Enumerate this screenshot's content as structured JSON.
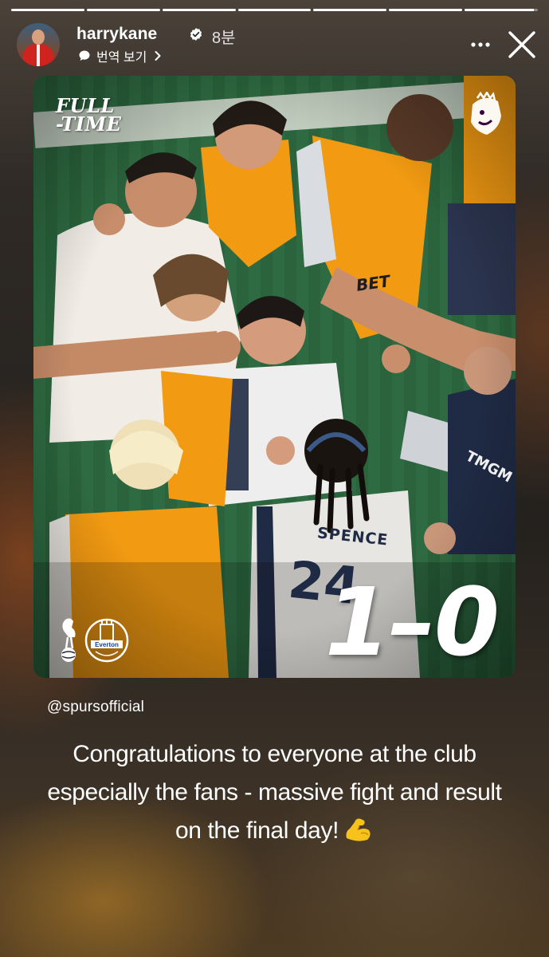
{
  "progress": {
    "segment_fill": [
      1,
      1,
      1,
      1,
      1,
      1,
      0.95
    ]
  },
  "header": {
    "username": "harrykane",
    "time_ago": "8분",
    "translate_label": "번역 보기"
  },
  "post": {
    "overlay_title": "FULL\n-TIME",
    "score": "1–0",
    "jersey_name": "SPENCE",
    "jersey_number": "24",
    "sponsor_chest": "BET",
    "sponsor_shirt": "TMGM",
    "away_crest_text": "Everton"
  },
  "mention": "@spursofficial",
  "caption": "Congratulations to everyone at the club especially the fans - massive fight and result on the final day!",
  "icons": {
    "verified": "verified-badge-icon",
    "translate": "speech-bubble-icon",
    "more": "more-options-icon",
    "close": "close-icon",
    "emoji": "flexed-biceps-emoji"
  },
  "colors": {
    "accent_orange": "#f29a12",
    "spurs_navy": "#1f2a44",
    "verified_blue": "#ffffff",
    "pitch_green": "#2f6b42"
  }
}
